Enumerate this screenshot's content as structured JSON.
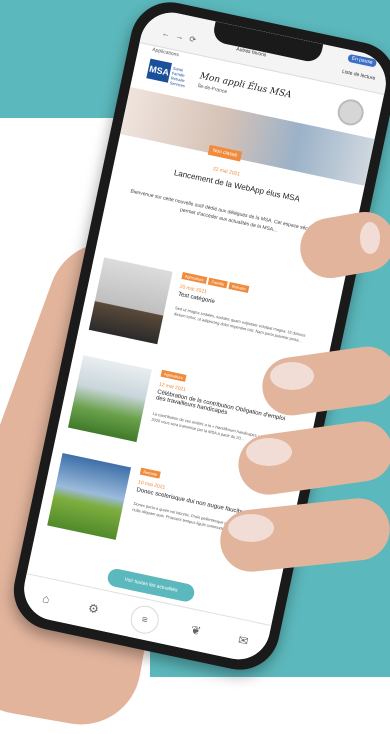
{
  "browser": {
    "time": "",
    "ingame_label": "En pause",
    "bookmark_other": "Autres favoris",
    "bookmark_reading": "Liste de lecture",
    "apps_label": "Applications"
  },
  "header": {
    "logo_letters": "MSA",
    "logo_small_text": "Santé Famille Retraite Services",
    "app_title": "Mon appli Élus MSA",
    "region": "Île-de-France"
  },
  "hero": {
    "badge": "Non classé",
    "date": "22 mai 2021",
    "title": "Lancement de la WebApp élus MSA",
    "text": "Bienvenue sur cette nouvelle outil dédié aux délégués de la MSA. Cet espace sécurisé vous permet d'accéder aux actualités de la MSA..."
  },
  "cards": [
    {
      "tags": [
        "Agriculture",
        "Famille",
        "Retraite"
      ],
      "date": "20 mai 2021",
      "title": "Test catégorie",
      "text": "Sed ut magna sodales, sodales quam vulputate volutpat magna. Ut dolores dictum tortor, ut adipiscing dolor imperdiet nisl. Nam porta pulvinar porta..."
    },
    {
      "tags": [
        "Agriculture"
      ],
      "date": "12 mai 2021",
      "title": "Célébration de la contribution Obligation d'emploi des travailleurs handicapés",
      "text": "La contribution de ces entités a la « Handiforum handicapés » pour l'année 2020 vous sera transmise par la MSA à partir du 20..."
    },
    {
      "tags": [
        "Retraite"
      ],
      "date": "10 mai 2021",
      "title": "Donec scelerisque dui non augue faucibus",
      "text": "Donec porta a quam vel lobortis. Proin pellentesque pulvinar odio, vel vehicula nulla aliquam quis. Praesent tempus ligula commodo suscipit sodales. Fusce..."
    }
  ],
  "cta": "Voir toutes les actualités",
  "nav": [
    "home-icon",
    "tractor-icon",
    "menu-icon",
    "agriculture-icon",
    "mail-icon"
  ],
  "colors": {
    "accent": "#5bb8bc",
    "tag": "#f08a3c",
    "brand": "#1a4f9a"
  }
}
